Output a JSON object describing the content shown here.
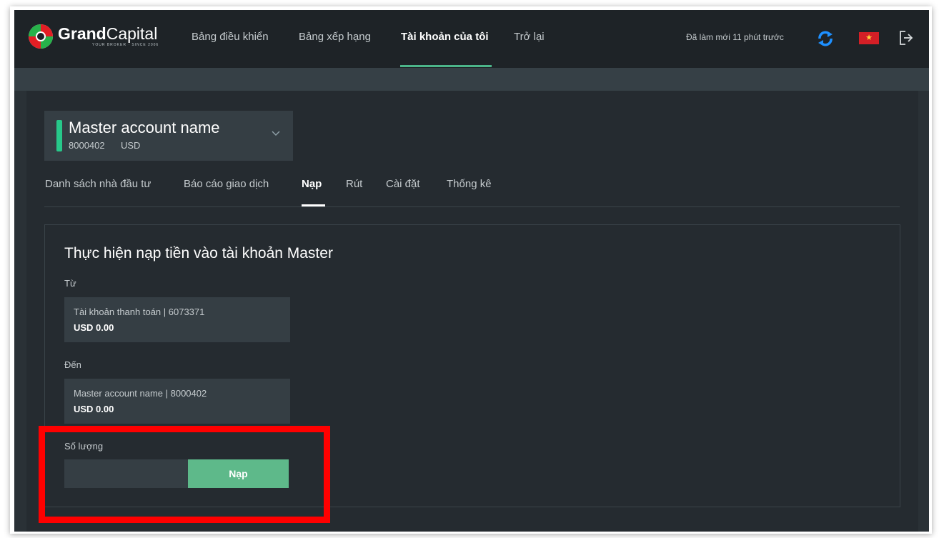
{
  "brand": {
    "name_bold": "Grand",
    "name_light": "Capital",
    "tagline": "YOUR BROKER · SINCE 2006"
  },
  "nav": {
    "items": [
      "Bảng điều khiển",
      "Bảng xếp hạng",
      "Tài khoản của tôi",
      "Trở lại"
    ],
    "active_index": 2
  },
  "header": {
    "refresh_text": "Đã làm mới 11 phút trước",
    "language_icon": "vietnam-flag-icon",
    "refresh_icon": "refresh-icon",
    "logout_icon": "logout-icon"
  },
  "account_selector": {
    "name": "Master account name",
    "number": "8000402",
    "currency": "USD"
  },
  "tabs": {
    "items": [
      "Danh sách nhà đầu tư",
      "Báo cáo giao dịch",
      "Nạp",
      "Rút",
      "Cài đặt",
      "Thống kê"
    ],
    "active_index": 2
  },
  "form": {
    "title": "Thực hiện nạp tiền vào tài khoản Master",
    "from_label": "Từ",
    "from_account": "Tài khoản thanh toán | 6073371",
    "from_balance": "USD 0.00",
    "to_label": "Đến",
    "to_account": "Master account name | 8000402",
    "to_balance": "USD 0.00",
    "amount_label": "Số lượng",
    "amount_value": "",
    "submit_label": "Nạp"
  },
  "colors": {
    "accent": "#4cb58a",
    "button": "#5eb98a",
    "highlight": "#ff0000",
    "background": "#252b30",
    "topbar": "#1e2327"
  }
}
